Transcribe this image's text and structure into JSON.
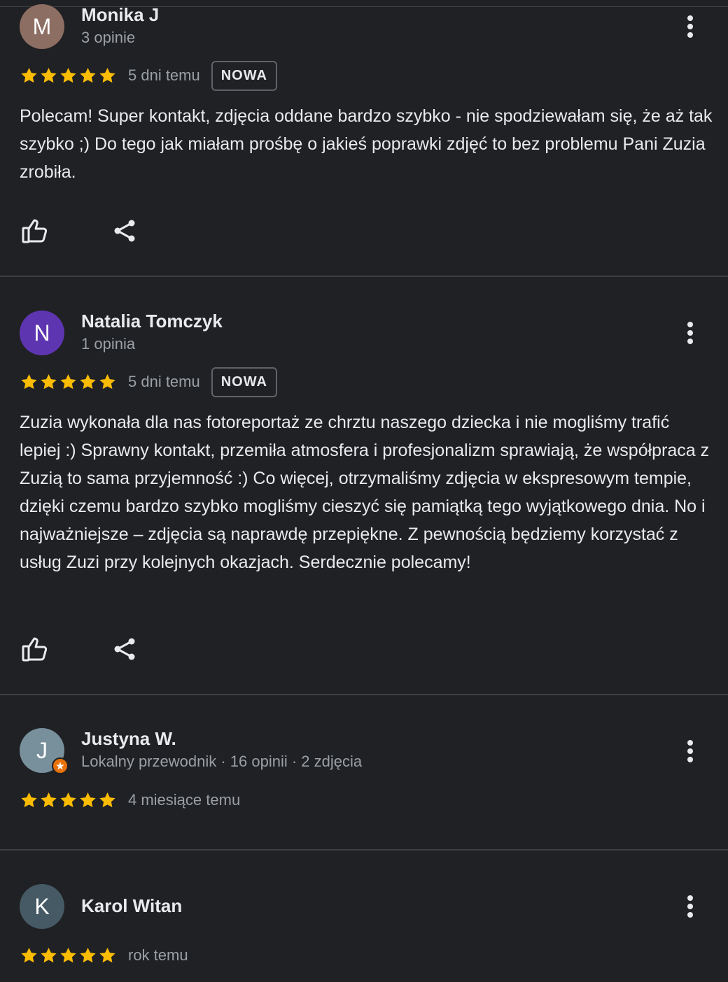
{
  "reviews": [
    {
      "name": "Monika J",
      "meta": "3 opinie",
      "avatar_letter": "M",
      "avatar_color": "#8d6e63",
      "date": "5 dni temu",
      "badge": "NOWA",
      "rating": 5,
      "text": "Polecam! Super kontakt, zdjęcia oddane bardzo szybko - nie spodziewałam się, że aż tak szybko ;) Do tego jak miałam prośbę o jakieś poprawki zdjęć to bez problemu Pani Zuzia zrobiła."
    },
    {
      "name": "Natalia Tomczyk",
      "meta": "1 opinia",
      "avatar_letter": "N",
      "avatar_color": "#5e35b1",
      "date": "5 dni temu",
      "badge": "NOWA",
      "rating": 5,
      "text": "Zuzia wykonała dla nas fotoreportaż ze chrztu naszego dziecka i nie mogliśmy trafić lepiej :) Sprawny kontakt, przemiła atmosfera i profesjonalizm sprawiają, że współpraca z Zuzią to sama przyjemność :) Co więcej, otrzymaliśmy zdjęcia w ekspresowym tempie, dzięki czemu bardzo szybko mogliśmy cieszyć się pamiątką tego wyjątkowego dnia. No i najważniejsze – zdjęcia są naprawdę przepiękne. Z pewnością będziemy korzystać z usług Zuzi przy kolejnych okazjach. Serdecznie polecamy!"
    },
    {
      "name": "Justyna W.",
      "meta": "Lokalny przewodnik · 16 opinii · 2 zdjęcia",
      "avatar_letter": "J",
      "avatar_color": "#78909c",
      "date": "4 miesiące temu",
      "rating": 5,
      "local_guide": true
    },
    {
      "name": "Karol Witan",
      "meta": "",
      "avatar_letter": "K",
      "avatar_color": "#455a64",
      "date": "rok temu",
      "rating": 5
    }
  ],
  "colors": {
    "star": "#fbbc04",
    "background": "#202124",
    "icon": "#e8eaed",
    "local_guide_badge": "#e8710a"
  },
  "icons": {
    "more": "more-vert-icon",
    "like": "thumb-up-icon",
    "share": "share-icon",
    "star": "star-icon",
    "local_guide": "local-guide-badge-icon"
  }
}
